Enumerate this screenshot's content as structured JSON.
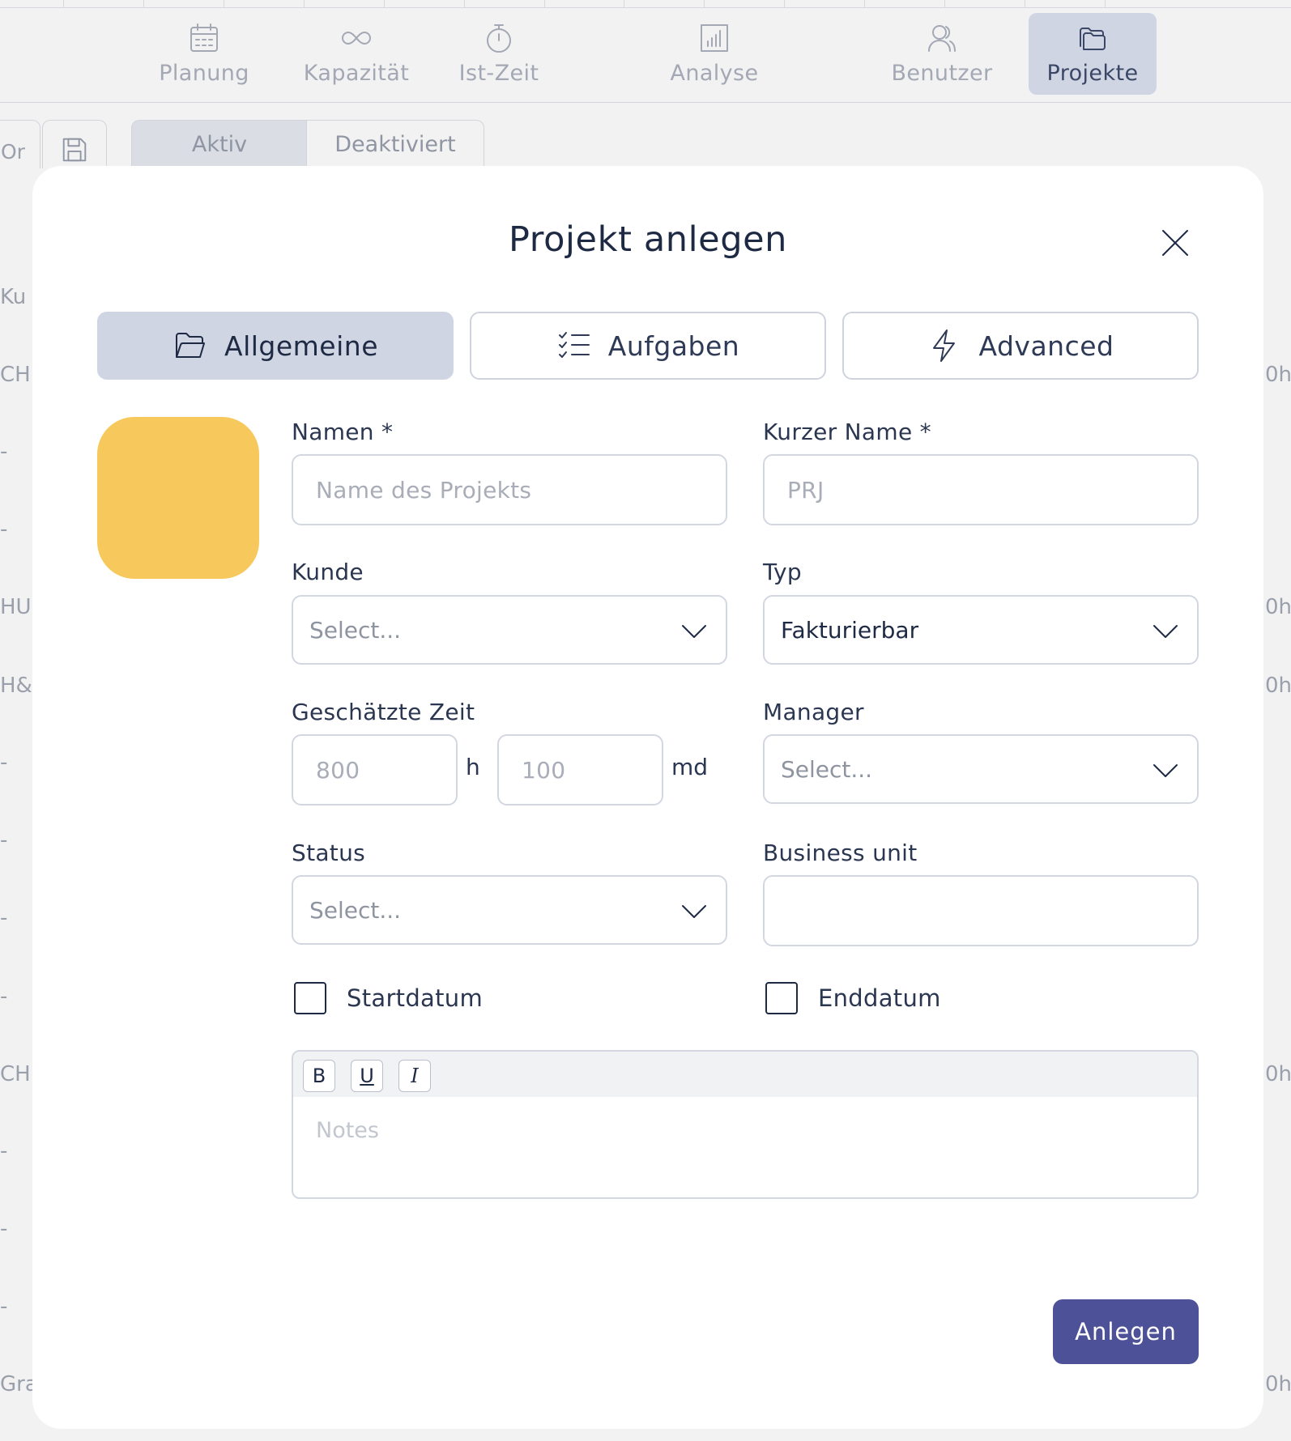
{
  "nav": {
    "items": [
      {
        "label": "Planung",
        "icon": "calendar-icon"
      },
      {
        "label": "Kapazität",
        "icon": "infinity-icon"
      },
      {
        "label": "Ist-Zeit",
        "icon": "stopwatch-icon"
      },
      {
        "label": "Analyse",
        "icon": "bar-chart-icon"
      },
      {
        "label": "Benutzer",
        "icon": "users-icon"
      },
      {
        "label": "Projekte",
        "icon": "folders-icon"
      }
    ],
    "active": "Projekte"
  },
  "background": {
    "toolbar_partial_text": "Or",
    "tabs": [
      "Aktiv",
      "Deaktiviert"
    ],
    "left_column": [
      "Ku",
      "CH",
      "-",
      "-",
      "HU",
      "H&",
      "-",
      "-",
      "-",
      "-",
      "CH",
      "-",
      "-",
      "-",
      "Gra"
    ],
    "right_column": [
      "0h",
      "0h",
      "0h",
      "0h",
      "0h"
    ]
  },
  "modal": {
    "title": "Projekt anlegen",
    "tabs": [
      {
        "label": "Allgemeine",
        "icon": "folder-open-icon",
        "active": true
      },
      {
        "label": "Aufgaben",
        "icon": "checklist-icon",
        "active": false
      },
      {
        "label": "Advanced",
        "icon": "lightning-icon",
        "active": false
      }
    ],
    "color_swatch": "#F7C95C",
    "fields": {
      "name": {
        "label": "Namen *",
        "placeholder": "Name des Projekts"
      },
      "short_name": {
        "label": "Kurzer Name *",
        "placeholder": "PRJ"
      },
      "customer": {
        "label": "Kunde",
        "value": "Select..."
      },
      "type": {
        "label": "Typ",
        "value": "Fakturierbar"
      },
      "estimated_time": {
        "label": "Geschätzte Zeit",
        "hours_placeholder": "800",
        "hours_unit": "h",
        "days_placeholder": "100",
        "days_unit": "md"
      },
      "manager": {
        "label": "Manager",
        "value": "Select..."
      },
      "status": {
        "label": "Status",
        "value": "Select..."
      },
      "business_unit": {
        "label": "Business unit",
        "value": ""
      },
      "start_date": {
        "label": "Startdatum",
        "checked": false
      },
      "end_date": {
        "label": "Enddatum",
        "checked": false
      }
    },
    "editor": {
      "buttons": [
        "B",
        "U",
        "I"
      ],
      "placeholder": "Notes"
    },
    "submit_label": "Anlegen"
  },
  "colors": {
    "primary": "#4D5298",
    "active_tab": "#CFD5E3",
    "text": "#1E2A44"
  }
}
